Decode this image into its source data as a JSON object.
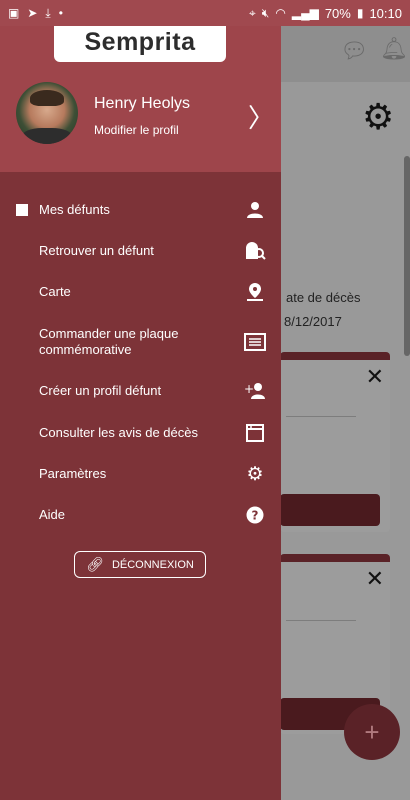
{
  "status_bar": {
    "left_icons": [
      "image-icon",
      "send-icon",
      "download-icon",
      "dot-icon"
    ],
    "battery": "70%",
    "time": "10:10"
  },
  "drawer": {
    "logo": "Semprita",
    "user": {
      "name": "Henry Heolys",
      "edit_label": "Modifier le profil"
    },
    "menu": [
      {
        "label": "Mes défunts",
        "icon": "person-icon",
        "selected": true
      },
      {
        "label": "Retrouver un défunt",
        "icon": "tombstone-search-icon",
        "selected": false
      },
      {
        "label": "Carte",
        "icon": "map-pin-icon",
        "selected": false
      },
      {
        "label": "Commander une plaque commémorative",
        "icon": "plaque-icon",
        "selected": false
      },
      {
        "label": "Créer un profil défunt",
        "icon": "add-person-icon",
        "selected": false
      },
      {
        "label": "Consulter les avis de décès",
        "icon": "notice-icon",
        "selected": false
      },
      {
        "label": "Paramètres",
        "icon": "gear-icon",
        "selected": false
      },
      {
        "label": "Aide",
        "icon": "help-icon",
        "selected": false
      }
    ],
    "logout_label": "DÉCONNEXION"
  },
  "background": {
    "column_label": "ate de décès",
    "date_value": "8/12/2017",
    "fab_label": "+"
  }
}
